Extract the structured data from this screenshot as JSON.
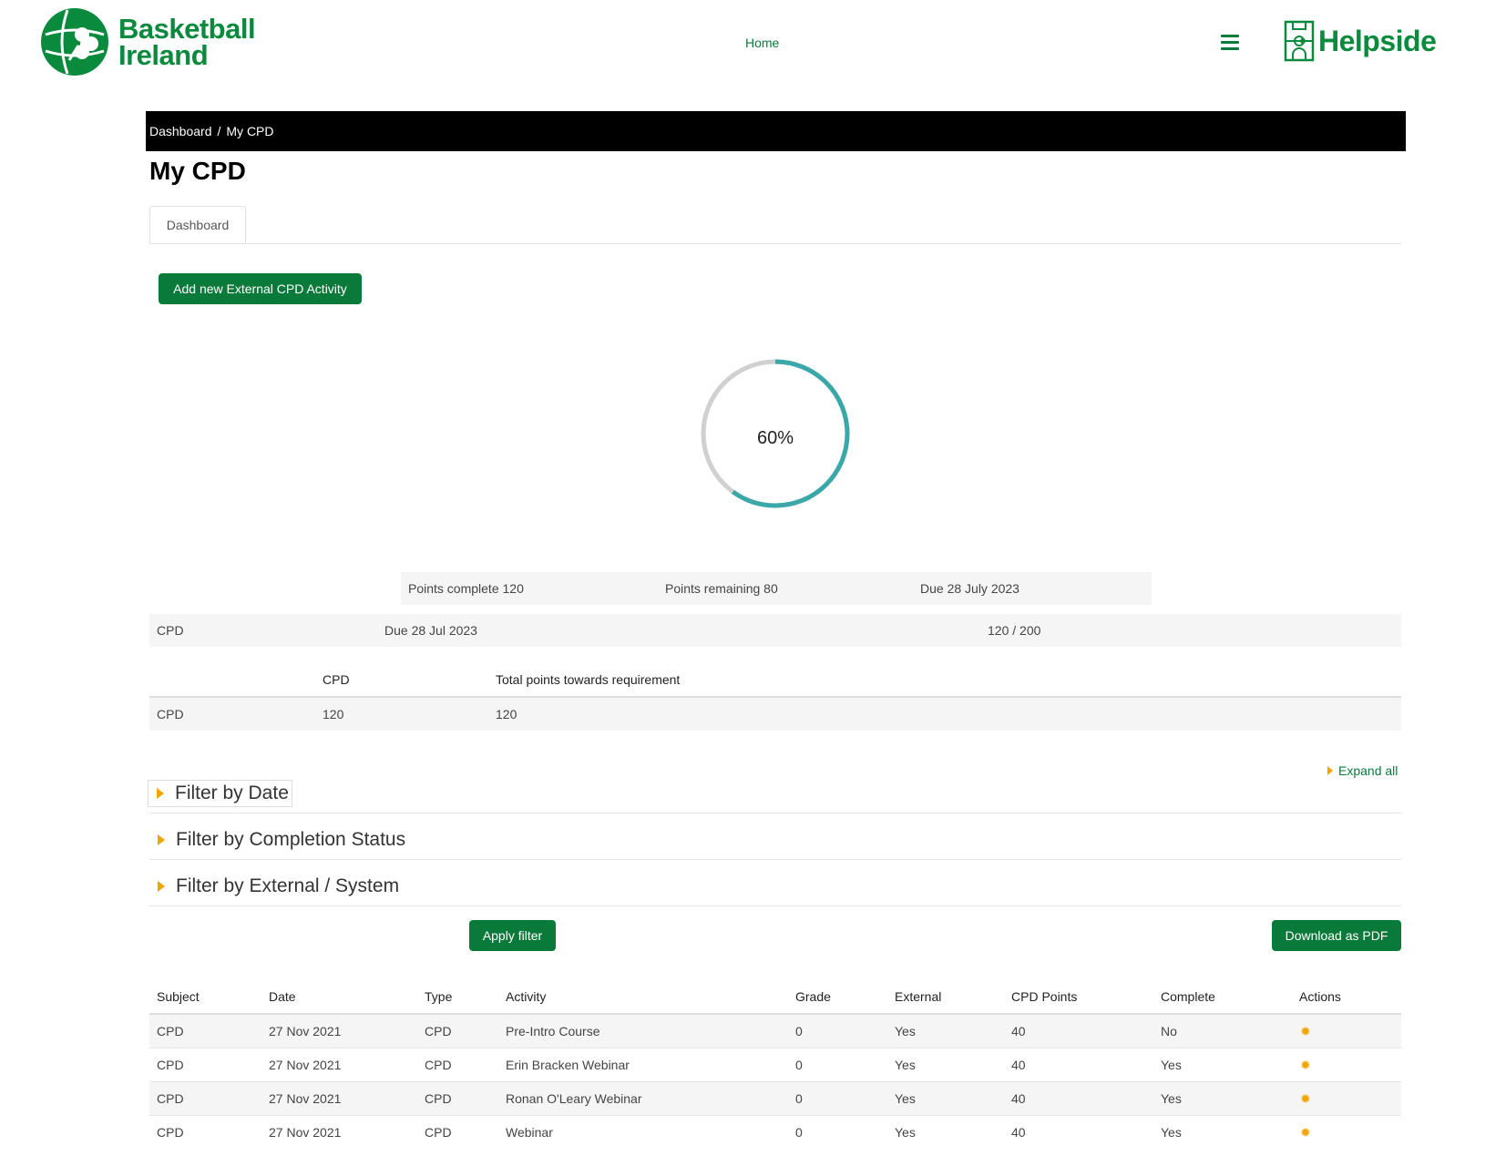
{
  "header": {
    "logo_text_line1": "Basketball",
    "logo_text_line2": "Ireland",
    "nav_home": "Home",
    "brand_right": "Helpside"
  },
  "breadcrumb": {
    "items": [
      "Dashboard",
      "My CPD"
    ],
    "separator": "/"
  },
  "page_title": "My CPD",
  "tabs": [
    {
      "label": "Dashboard",
      "active": true
    }
  ],
  "add_button": "Add new External CPD Activity",
  "progress": {
    "label": "60%",
    "value": 0.6,
    "track_color": "#d0d0d0",
    "fill_color": "#3aa8a8"
  },
  "summary": {
    "complete": "Points complete 120",
    "remaining": "Points remaining 80",
    "due": "Due 28 July 2023"
  },
  "requirement_row": {
    "subject": "CPD",
    "due": "Due 28 Jul 2023",
    "points": "120 / 200"
  },
  "points_table": {
    "headers": [
      "",
      "CPD",
      "Total points towards requirement"
    ],
    "row": [
      "CPD",
      "120",
      "120"
    ]
  },
  "expand_all": "Expand all",
  "filters": [
    "Filter by Date",
    "Filter by Completion Status",
    "Filter by External / System"
  ],
  "apply_filter": "Apply filter",
  "download_pdf": "Download as PDF",
  "activity_table": {
    "headers": [
      "Subject",
      "Date",
      "Type",
      "Activity",
      "Grade",
      "External",
      "CPD Points",
      "Complete",
      "Actions"
    ],
    "rows": [
      [
        "CPD",
        "27 Nov 2021",
        "CPD",
        "Pre-Intro Course",
        "0",
        "Yes",
        "40",
        "No"
      ],
      [
        "CPD",
        "27 Nov 2021",
        "CPD",
        "Erin Bracken Webinar",
        "0",
        "Yes",
        "40",
        "Yes"
      ],
      [
        "CPD",
        "27 Nov 2021",
        "CPD",
        "Ronan O'Leary Webinar",
        "0",
        "Yes",
        "40",
        "Yes"
      ],
      [
        "CPD",
        "27 Nov 2021",
        "CPD",
        "Webinar",
        "0",
        "Yes",
        "40",
        "Yes"
      ]
    ]
  },
  "colors": {
    "brand_green": "#0a8a3c",
    "button_green": "#0a7a3a",
    "accent_orange": "#f0a500"
  }
}
